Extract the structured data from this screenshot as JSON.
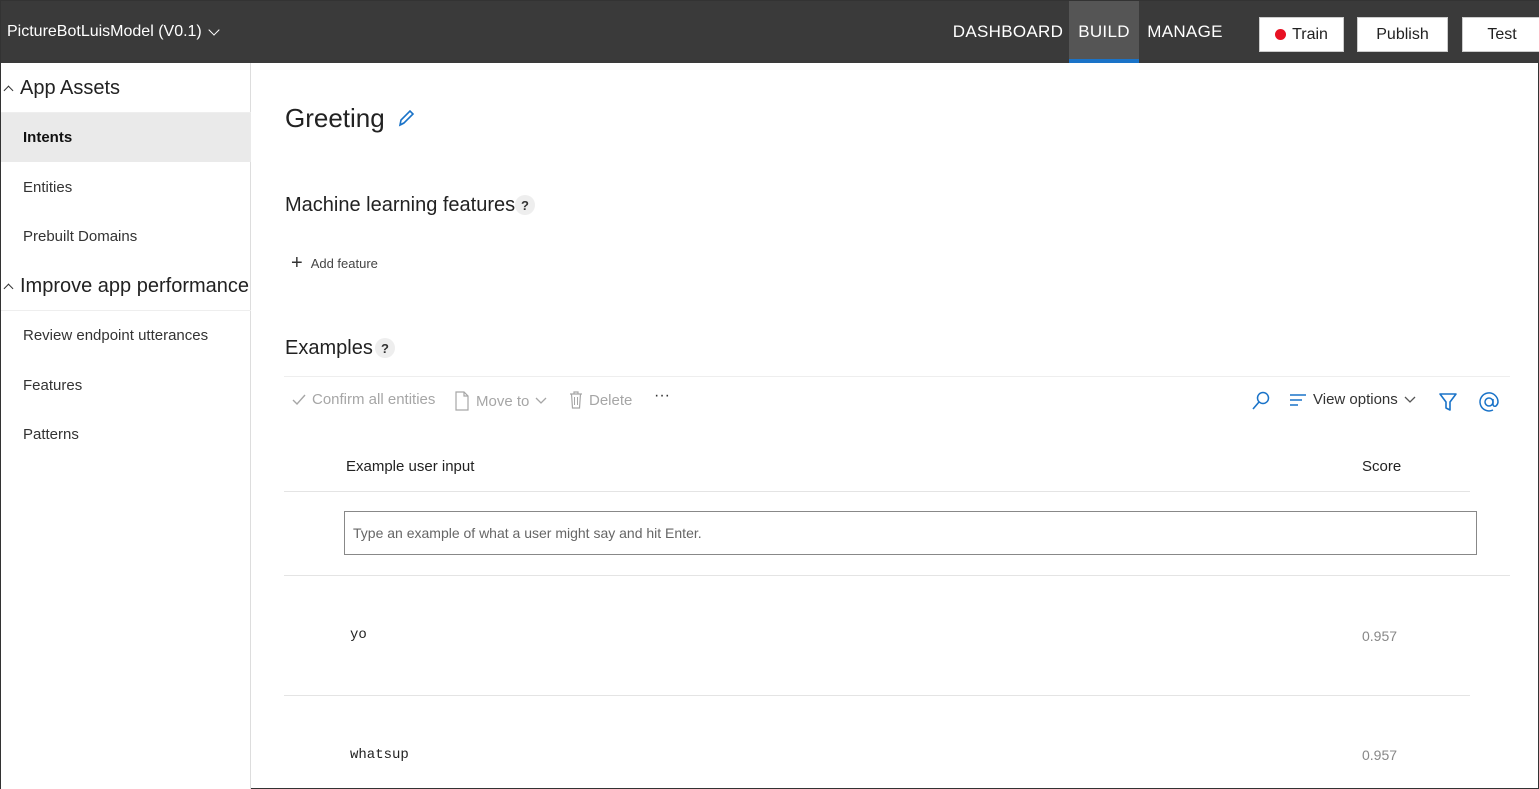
{
  "header": {
    "app_name": "PictureBotLuisModel (V0.1)",
    "nav": [
      "DASHBOARD",
      "BUILD",
      "MANAGE"
    ],
    "train_label": "Train",
    "publish_label": "Publish",
    "test_label": "Test"
  },
  "sidebar": {
    "section1": "App Assets",
    "items1": [
      "Intents",
      "Entities",
      "Prebuilt Domains"
    ],
    "section2": "Improve app performance",
    "items2": [
      "Review endpoint utterances",
      "Features",
      "Patterns"
    ]
  },
  "main": {
    "title": "Greeting",
    "ml_features_heading": "Machine learning features",
    "help_glyph": "?",
    "add_feature_label": "Add feature",
    "examples_heading": "Examples",
    "toolbar": {
      "confirm_label": "Confirm all entities",
      "move_label": "Move to",
      "delete_label": "Delete",
      "more_label": "···",
      "view_options_label": "View options"
    },
    "table": {
      "col_input": "Example user input",
      "col_score": "Score",
      "input_placeholder": "Type an example of what a user might say and hit Enter.",
      "rows": [
        {
          "text": "yo",
          "score": "0.957"
        },
        {
          "text": "whatsup",
          "score": "0.957"
        }
      ]
    }
  },
  "colors": {
    "accent": "#1a73c8",
    "topbar": "#3a3a3a",
    "train_dot": "#e81123"
  }
}
